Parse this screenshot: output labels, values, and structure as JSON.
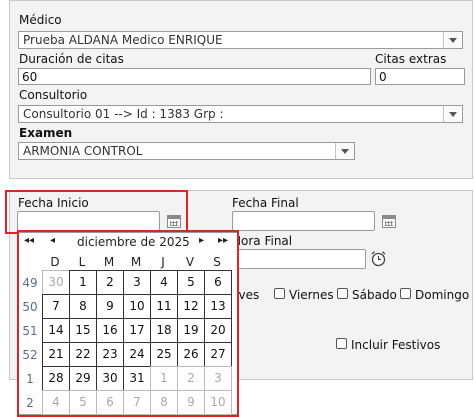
{
  "top": {
    "medico_label": "Médico",
    "medico_value": "Prueba ALDANA Medico ENRIQUE",
    "duracion_label": "Duración de citas",
    "duracion_value": "60",
    "extras_label": "Citas extras",
    "extras_value": "0",
    "consultorio_label": "Consultorio",
    "consultorio_value": "Consultorio 01 --> Id : 1383 Grp :",
    "examen_label": "Examen",
    "examen_value": "ARMONIA CONTROL"
  },
  "dates": {
    "fecha_inicio_label": "Fecha Inicio",
    "fecha_inicio_value": "",
    "fecha_final_label": "Fecha Final",
    "fecha_final_value": "",
    "hora_final_label": "Hora Final",
    "hora_final_value": ""
  },
  "days": {
    "jueves": "Jueves",
    "viernes": "Viernes",
    "sabado": "Sábado",
    "domingo": "Domingo",
    "festivos": "Incluir Festivos"
  },
  "calendar": {
    "month_label": "diciembre de 2025",
    "nav_prev_year": "◂◂",
    "nav_prev": "◂",
    "nav_next": "▸",
    "nav_next_year": "▸▸",
    "weekdays": [
      "D",
      "L",
      "M",
      "M",
      "J",
      "V",
      "S"
    ],
    "weeks": [
      {
        "num": "49",
        "days": [
          {
            "d": "30",
            "o": true
          },
          {
            "d": "1"
          },
          {
            "d": "2"
          },
          {
            "d": "3"
          },
          {
            "d": "4"
          },
          {
            "d": "5"
          },
          {
            "d": "6"
          }
        ]
      },
      {
        "num": "50",
        "days": [
          {
            "d": "7"
          },
          {
            "d": "8"
          },
          {
            "d": "9"
          },
          {
            "d": "10"
          },
          {
            "d": "11"
          },
          {
            "d": "12"
          },
          {
            "d": "13"
          }
        ]
      },
      {
        "num": "51",
        "days": [
          {
            "d": "14"
          },
          {
            "d": "15"
          },
          {
            "d": "16"
          },
          {
            "d": "17"
          },
          {
            "d": "18"
          },
          {
            "d": "19"
          },
          {
            "d": "20"
          }
        ]
      },
      {
        "num": "52",
        "days": [
          {
            "d": "21"
          },
          {
            "d": "22"
          },
          {
            "d": "23"
          },
          {
            "d": "24"
          },
          {
            "d": "25"
          },
          {
            "d": "26"
          },
          {
            "d": "27"
          }
        ]
      },
      {
        "num": "1",
        "days": [
          {
            "d": "28"
          },
          {
            "d": "29"
          },
          {
            "d": "30"
          },
          {
            "d": "31"
          },
          {
            "d": "1",
            "o": true
          },
          {
            "d": "2",
            "o": true
          },
          {
            "d": "3",
            "o": true
          }
        ]
      },
      {
        "num": "2",
        "days": [
          {
            "d": "4",
            "o": true
          },
          {
            "d": "5",
            "o": true
          },
          {
            "d": "6",
            "o": true
          },
          {
            "d": "7",
            "o": true
          },
          {
            "d": "8",
            "o": true
          },
          {
            "d": "9",
            "o": true
          },
          {
            "d": "10",
            "o": true
          }
        ]
      }
    ]
  },
  "colors": {
    "highlight_red": "#d9262c",
    "panel_bg": "#f3f3f3"
  }
}
